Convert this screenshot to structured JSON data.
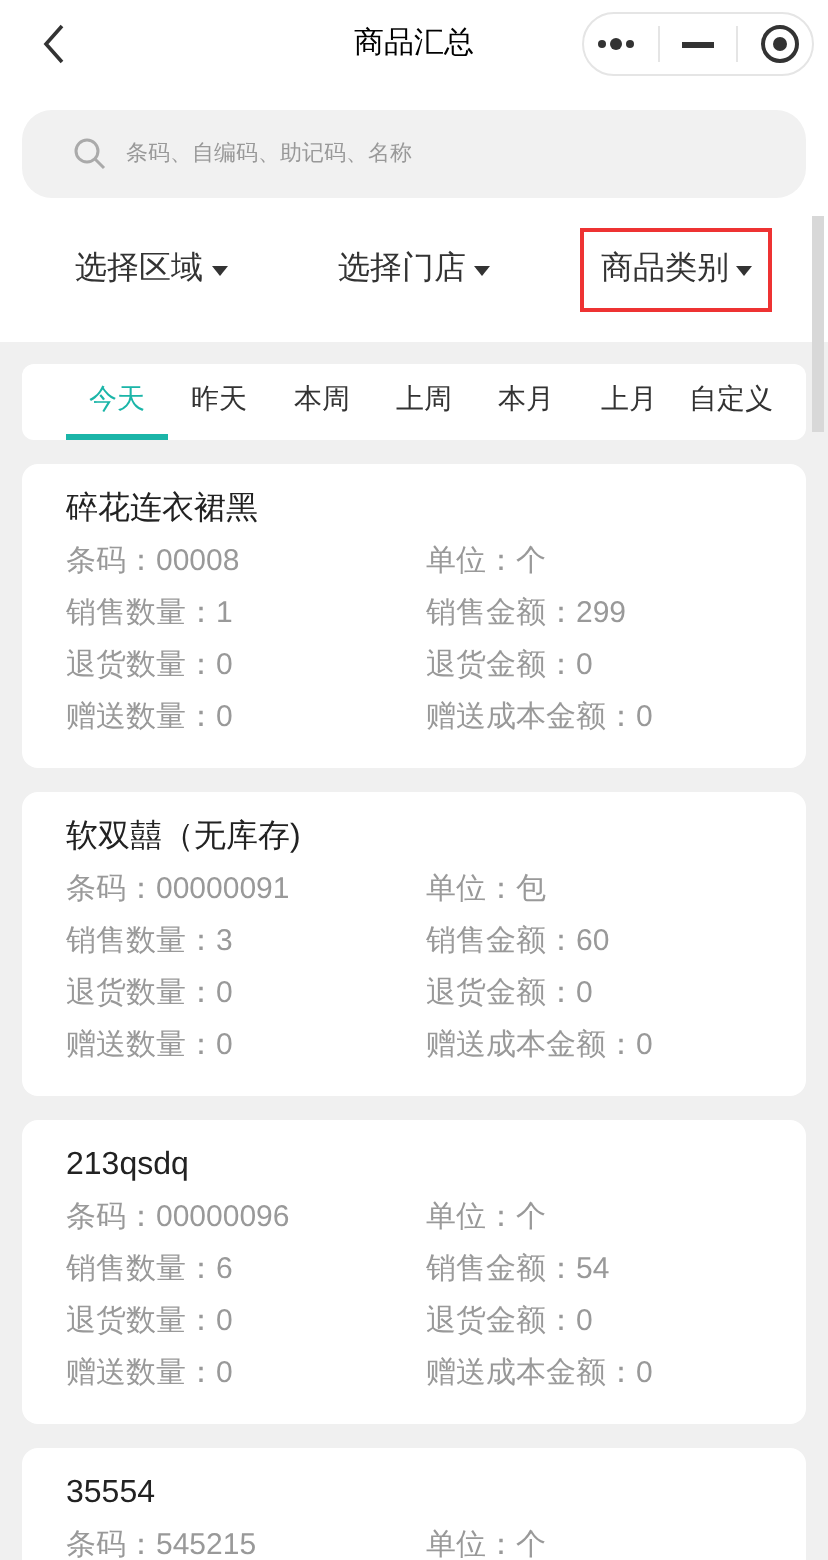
{
  "header": {
    "title": "商品汇总"
  },
  "search": {
    "placeholder": "条码、自编码、助记码、名称"
  },
  "filters": [
    {
      "label": "选择区域",
      "highlighted": false
    },
    {
      "label": "选择门店",
      "highlighted": false
    },
    {
      "label": "商品类别",
      "highlighted": true
    }
  ],
  "tabs": [
    {
      "label": "今天",
      "selected": true
    },
    {
      "label": "昨天",
      "selected": false
    },
    {
      "label": "本周",
      "selected": false
    },
    {
      "label": "上周",
      "selected": false
    },
    {
      "label": "本月",
      "selected": false
    },
    {
      "label": "上月",
      "selected": false
    },
    {
      "label": "自定义",
      "selected": false
    }
  ],
  "products": [
    {
      "name": "碎花连衣裙黑",
      "fields": [
        "条码：00008",
        "单位：个",
        "销售数量：1",
        "销售金额：299",
        "退货数量：0",
        "退货金额：0",
        "赠送数量：0",
        "赠送成本金额：0"
      ]
    },
    {
      "name": "软双囍（无库存)",
      "fields": [
        "条码：00000091",
        "单位：包",
        "销售数量：3",
        "销售金额：60",
        "退货数量：0",
        "退货金额：0",
        "赠送数量：0",
        "赠送成本金额：0"
      ]
    },
    {
      "name": "213qsdq",
      "fields": [
        "条码：00000096",
        "单位：个",
        "销售数量：6",
        "销售金额：54",
        "退货数量：0",
        "退货金额：0",
        "赠送数量：0",
        "赠送成本金额：0"
      ]
    },
    {
      "name": "35554",
      "fields": [
        "条码：545215",
        "单位：个"
      ]
    }
  ]
}
